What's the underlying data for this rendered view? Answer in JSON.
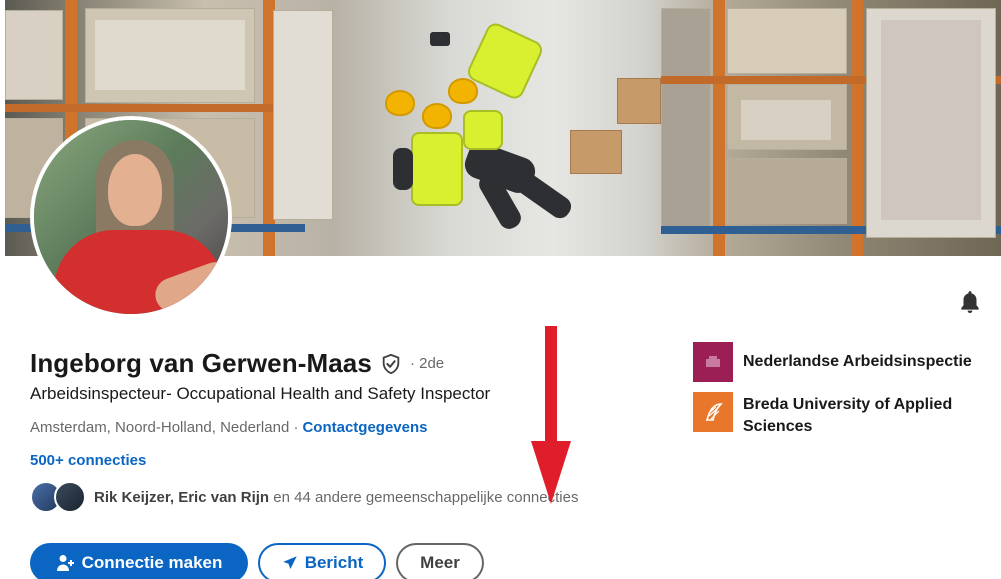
{
  "profile": {
    "name": "Ingeborg van Gerwen-Maas",
    "degree": "· 2de",
    "headline": "Arbeidsinspecteur- Occupational Health and Safety Inspector",
    "location": "Amsterdam, Noord-Holland, Nederland ·",
    "contact_label": "Contactgegevens",
    "connections": "500+ connecties",
    "mutual": {
      "names": "Rik Keijzer, Eric van Rijn",
      "rest": " en 44 andere gemeenschappelijke connecties"
    }
  },
  "actions": {
    "connect": "Connectie maken",
    "message": "Bericht",
    "more": "Meer"
  },
  "orgs": [
    {
      "name": "Nederlandse Arbeidsinspectie",
      "logo_color": "#9b1f55"
    },
    {
      "name": "Breda University of Applied Sciences",
      "logo_color": "#e8762b"
    }
  ],
  "colors": {
    "link_blue": "#0a66c2",
    "arrow_red": "#e01e2b"
  }
}
